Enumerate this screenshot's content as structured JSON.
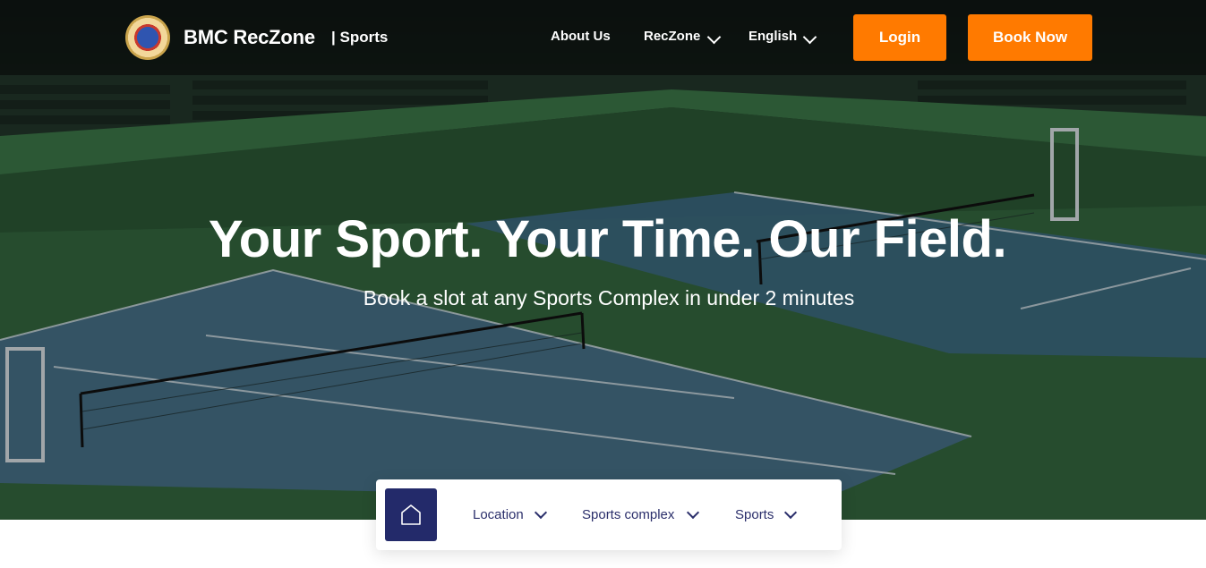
{
  "brand": {
    "name": "BMC RecZone",
    "section": "| Sports"
  },
  "nav": {
    "about": "About Us",
    "reczone": "RecZone",
    "language": "English",
    "login": "Login",
    "book_now": "Book Now"
  },
  "hero": {
    "headline": "Your Sport. Your Time. Our Field.",
    "subline": "Book a slot at any Sports Complex in under 2 minutes"
  },
  "search": {
    "home_icon": "home-icon",
    "location": "Location",
    "complex": "Sports complex",
    "sports": "Sports"
  },
  "colors": {
    "accent": "#ff7a00",
    "navy": "#232a6a",
    "navbar": "#0a0e0c"
  }
}
